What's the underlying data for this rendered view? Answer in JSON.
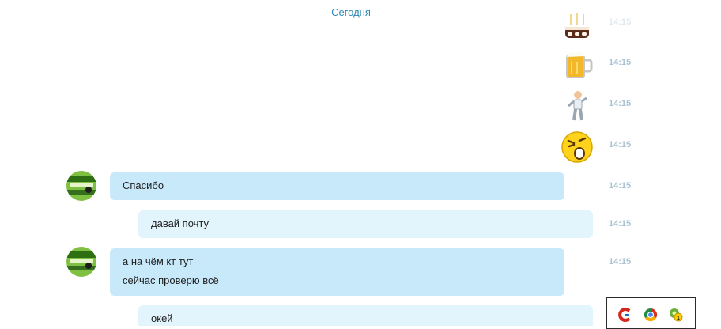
{
  "chat": {
    "date_divider": "Сегодня",
    "emoticon_rows": [
      {
        "icon": "birthday-cake-icon",
        "time": "14:15"
      },
      {
        "icon": "beer-mug-icon",
        "time": "14:15"
      },
      {
        "icon": "dancing-man-icon",
        "time": "14:15"
      },
      {
        "icon": "sad-smiley-icon",
        "time": "14:15"
      }
    ],
    "messages": [
      {
        "direction": "incoming",
        "lines": [
          "Спасибо"
        ],
        "time": "14:15"
      },
      {
        "direction": "outgoing",
        "lines": [
          "давай почту"
        ],
        "time": "14:15"
      },
      {
        "direction": "incoming",
        "lines": [
          "а на чём кт тут",
          "сейчас проверю всё"
        ],
        "time": "14:15"
      },
      {
        "direction": "outgoing",
        "lines": [
          "окей"
        ],
        "time": ""
      }
    ]
  },
  "tray": {
    "icons": [
      "ccleaner-icon",
      "chrome-icon",
      "icq-flower-icon"
    ],
    "badge": "1"
  },
  "colors": {
    "incoming_bubble": "#c7e9fa",
    "outgoing_bubble": "#e2f4fc",
    "timestamp": "#a9c2d2",
    "date_divider": "#2a8ab7"
  }
}
